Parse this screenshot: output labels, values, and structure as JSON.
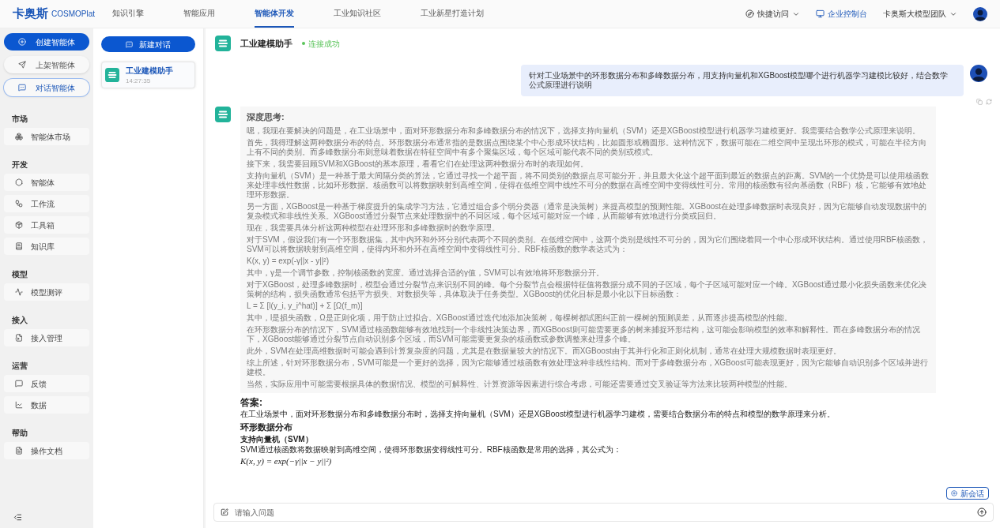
{
  "header": {
    "logo": {
      "brand": "卡奥斯",
      "sub": "COSMOPlat"
    },
    "nav": [
      {
        "label": "知识引擎",
        "selected": false
      },
      {
        "label": "智能应用",
        "selected": false
      },
      {
        "label": "智能体开发",
        "selected": true
      },
      {
        "label": "工业知识社区",
        "selected": false
      },
      {
        "label": "工业新星打造计划",
        "selected": false
      }
    ],
    "quick_access": "快捷访问",
    "console": "企业控制台",
    "team": "卡奥斯大模型团队"
  },
  "sidebar": {
    "actions": [
      {
        "label": "创建智能体",
        "kind": "primary",
        "selected": false
      },
      {
        "label": "上架智能体",
        "kind": "plain",
        "selected": false
      },
      {
        "label": "对话智能体",
        "kind": "plain",
        "selected": true
      }
    ],
    "sections": [
      {
        "title": "市场",
        "items": [
          "智能体市场"
        ]
      },
      {
        "title": "开发",
        "items": [
          "智能体",
          "工作流",
          "工具箱",
          "知识库"
        ]
      },
      {
        "title": "模型",
        "items": [
          "模型测评"
        ]
      },
      {
        "title": "接入",
        "items": [
          "接入管理"
        ]
      },
      {
        "title": "运营",
        "items": [
          "反馈",
          "数据"
        ]
      },
      {
        "title": "帮助",
        "items": [
          "操作文档"
        ]
      }
    ]
  },
  "conversations": {
    "new_button": "新建对话",
    "items": [
      {
        "title": "工业建模助手",
        "time": "14:27:35",
        "selected": true
      }
    ]
  },
  "chat": {
    "agent_name": "工业建模助手",
    "status": "连接成功",
    "connected": true,
    "user_message": "针对工业场景中的环形数据分布和多峰数据分布，用支持向量机和XGBoost模型哪个进行机器学习建模比较好，结合数学公式原理进行说明",
    "thinking": {
      "title": "深度思考:",
      "paragraphs": [
        "嗯，我现在要解决的问题是，在工业场景中，面对环形数据分布和多峰数据分布的情况下，选择支持向量机（SVM）还是XGBoost模型进行机器学习建模更好。我需要结合数学公式原理来说明。",
        "首先，我得理解这两种数据分布的特点。环形数据分布通常指的是数据点围绕某个中心形成环状结构，比如圆形或椭圆形。这种情况下，数据可能在二维空间中呈现出环形的模式，可能在半径方向上有不同的类别。而多峰数据分布则意味着数据在特征空间中有多个聚集区域，每个区域可能代表不同的类别或模式。",
        "接下来，我需要回顾SVM和XGBoost的基本原理，看看它们在处理这两种数据分布时的表现如何。",
        "支持向量机（SVM）是一种基于最大间隔分类的算法，它通过寻找一个超平面，将不同类别的数据点尽可能分开，并且最大化这个超平面到最近的数据点的距离。SVM的一个优势是可以使用核函数来处理非线性数据，比如环形数据。核函数可以将数据映射到高维空间，使得在低维空间中线性不可分的数据在高维空间中变得线性可分。常用的核函数有径向基函数（RBF）核，它能够有效地处理环形数据。",
        "另一方面，XGBoost是一种基于梯度提升的集成学习方法，它通过组合多个弱分类器（通常是决策树）来提高模型的预测性能。XGBoost在处理多峰数据时表现良好，因为它能够自动发现数据中的复杂模式和非线性关系。XGBoost通过分裂节点来处理数据中的不同区域，每个区域可能对应一个峰，从而能够有效地进行分类或回归。",
        "现在，我需要具体分析这两种模型在处理环形和多峰数据时的数学原理。",
        "对于SVM，假设我们有一个环形数据集，其中内环和外环分别代表两个不同的类别。在低维空间中，这两个类别是线性不可分的，因为它们围绕着同一个中心形成环状结构。通过使用RBF核函数，SVM可以将数据映射到高维空间，使得内环和外环在高维空间中变得线性可分。RBF核函数的数学表达式为：",
        "K(x, y) = exp(-γ||x - y||²)",
        "其中，γ是一个调节参数，控制核函数的宽度。通过选择合适的γ值，SVM可以有效地将环形数据分开。",
        "对于XGBoost，处理多峰数据时，模型会通过分裂节点来识别不同的峰。每个分裂节点会根据特征值将数据分成不同的子区域，每个子区域可能对应一个峰。XGBoost通过最小化损失函数来优化决策树的结构，损失函数通常包括平方损失、对数损失等，具体取决于任务类型。XGBoost的优化目标是最小化以下目标函数：",
        "L = Σ [l(y_i, y_i^hat)] + Σ [Ω(f_m)]",
        "其中，l是损失函数，Ω是正则化项，用于防止过拟合。XGBoost通过迭代地添加决策树，每棵树都试图纠正前一棵树的预测误差，从而逐步提高模型的性能。",
        "在环形数据分布的情况下，SVM通过核函数能够有效地找到一个非线性决策边界，而XGBoost则可能需要更多的树来捕捉环形结构，这可能会影响模型的效率和解释性。而在多峰数据分布的情况下，XGBoost能够通过分裂节点自动识别多个区域，而SVM可能需要更复杂的核函数或参数调整来处理多个峰。",
        "此外，SVM在处理高维数据时可能会遇到计算复杂度的问题，尤其是在数据量较大的情况下。而XGBoost由于其并行化和正则化机制，通常在处理大规模数据时表现更好。",
        "综上所述，针对环形数据分布，SVM可能是一个更好的选择，因为它能够通过核函数有效处理这种非线性结构。而对于多峰数据分布，XGBoost可能表现更好，因为它能够自动识别多个区域并进行建模。",
        "当然，实际应用中可能需要根据具体的数据情况、模型的可解释性、计算资源等因素进行综合考虑，可能还需要通过交叉验证等方法来比较两种模型的性能。"
      ]
    },
    "answer": {
      "title": "答案:",
      "intro": "在工业场景中，面对环形数据分布和多峰数据分布时，选择支持向量机（SVM）还是XGBoost模型进行机器学习建模，需要结合数据分布的特点和模型的数学原理来分析。",
      "section": "环形数据分布",
      "subsection": "支持向量机（SVM）",
      "text": "SVM通过核函数将数据映射到高维空间，使得环形数据变得线性可分。RBF核函数是常用的选择，其公式为：",
      "formula": "K(x, y) = exp(−γ||x − y||²)"
    },
    "new_session": "新会话",
    "input": {
      "placeholder": "请输入问题"
    }
  }
}
